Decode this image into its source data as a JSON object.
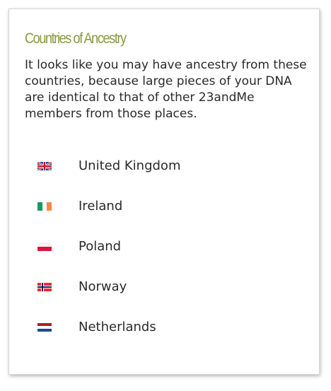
{
  "card": {
    "title": "Countries of Ancestry",
    "description": "It looks like you may have ancestry from these countries, because large pieces of your DNA are identical to that of other 23andMe members from those places."
  },
  "countries": [
    {
      "name": "United Kingdom",
      "flag_icon": "uk-flag-icon"
    },
    {
      "name": "Ireland",
      "flag_icon": "ireland-flag-icon"
    },
    {
      "name": "Poland",
      "flag_icon": "poland-flag-icon"
    },
    {
      "name": "Norway",
      "flag_icon": "norway-flag-icon"
    },
    {
      "name": "Netherlands",
      "flag_icon": "netherlands-flag-icon"
    }
  ],
  "colors": {
    "title": "#8a9a3c",
    "text": "#2a2a2a",
    "border": "#d6d6d6"
  }
}
